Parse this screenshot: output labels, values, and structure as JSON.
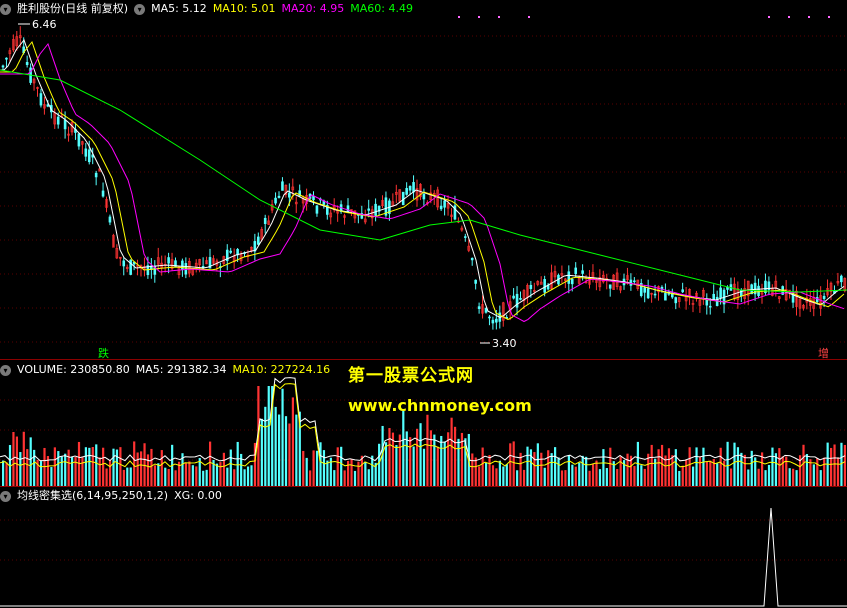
{
  "main_header": {
    "stock": "胜利股份(日线 前复权)",
    "ma5": "MA5: 5.12",
    "ma10": "MA10: 5.01",
    "ma20": "MA20: 4.95",
    "ma60": "MA60: 4.49"
  },
  "volume_header": {
    "volume": "VOLUME: 230850.80",
    "ma5": "MA5: 291382.34",
    "ma10": "MA10: 227224.16"
  },
  "indicator_header": {
    "name": "均线密集选(6,14,95,250,1,2)",
    "xg": "XG: 0.00"
  },
  "annotations": {
    "high": "6.46",
    "low": "3.40",
    "tag_left": "跌",
    "tag_right": "增"
  },
  "watermark": {
    "line1": "第一股票公式网",
    "line2": "www.chnmoney.com"
  },
  "colors": {
    "up": "#ff3333",
    "down": "#54ffff",
    "ma5": "#ffffff",
    "ma10": "#ffff00",
    "ma20": "#ff00ff",
    "ma60": "#00ff00",
    "divider": "#8b0000"
  }
}
